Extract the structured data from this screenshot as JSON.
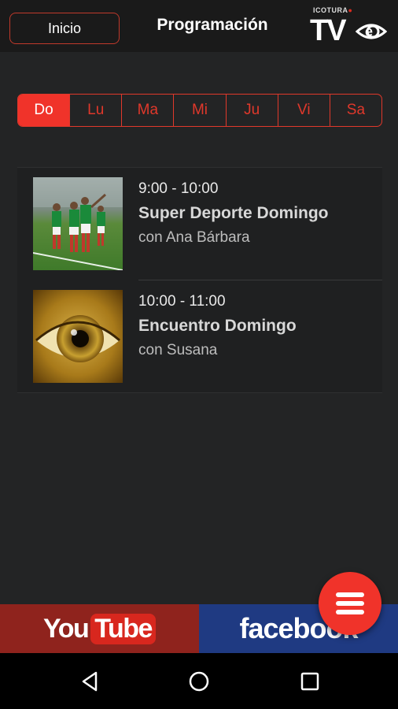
{
  "header": {
    "back_label": "Inicio",
    "title": "Programación",
    "logo_small_text": "ICOTURA",
    "logo_main": "TV"
  },
  "days": [
    {
      "label": "Do",
      "active": true
    },
    {
      "label": "Lu",
      "active": false
    },
    {
      "label": "Ma",
      "active": false
    },
    {
      "label": "Mi",
      "active": false
    },
    {
      "label": "Ju",
      "active": false
    },
    {
      "label": "Vi",
      "active": false
    },
    {
      "label": "Sa",
      "active": false
    }
  ],
  "programs": [
    {
      "time": "9:00 - 10:00",
      "title": "Super Deporte Domingo",
      "host": "con Ana Bárbara",
      "thumb": "soccer-players-image"
    },
    {
      "time": "10:00 - 11:00",
      "title": "Encuentro Domingo",
      "host": "con Susana",
      "thumb": "golden-eye-image"
    }
  ],
  "social": {
    "youtube_you": "You",
    "youtube_tube": "Tube",
    "facebook": "facebook"
  },
  "colors": {
    "accent": "#f0332a",
    "background": "#232425",
    "youtube_bg": "#8f231d",
    "facebook_bg": "#1f3a82"
  }
}
